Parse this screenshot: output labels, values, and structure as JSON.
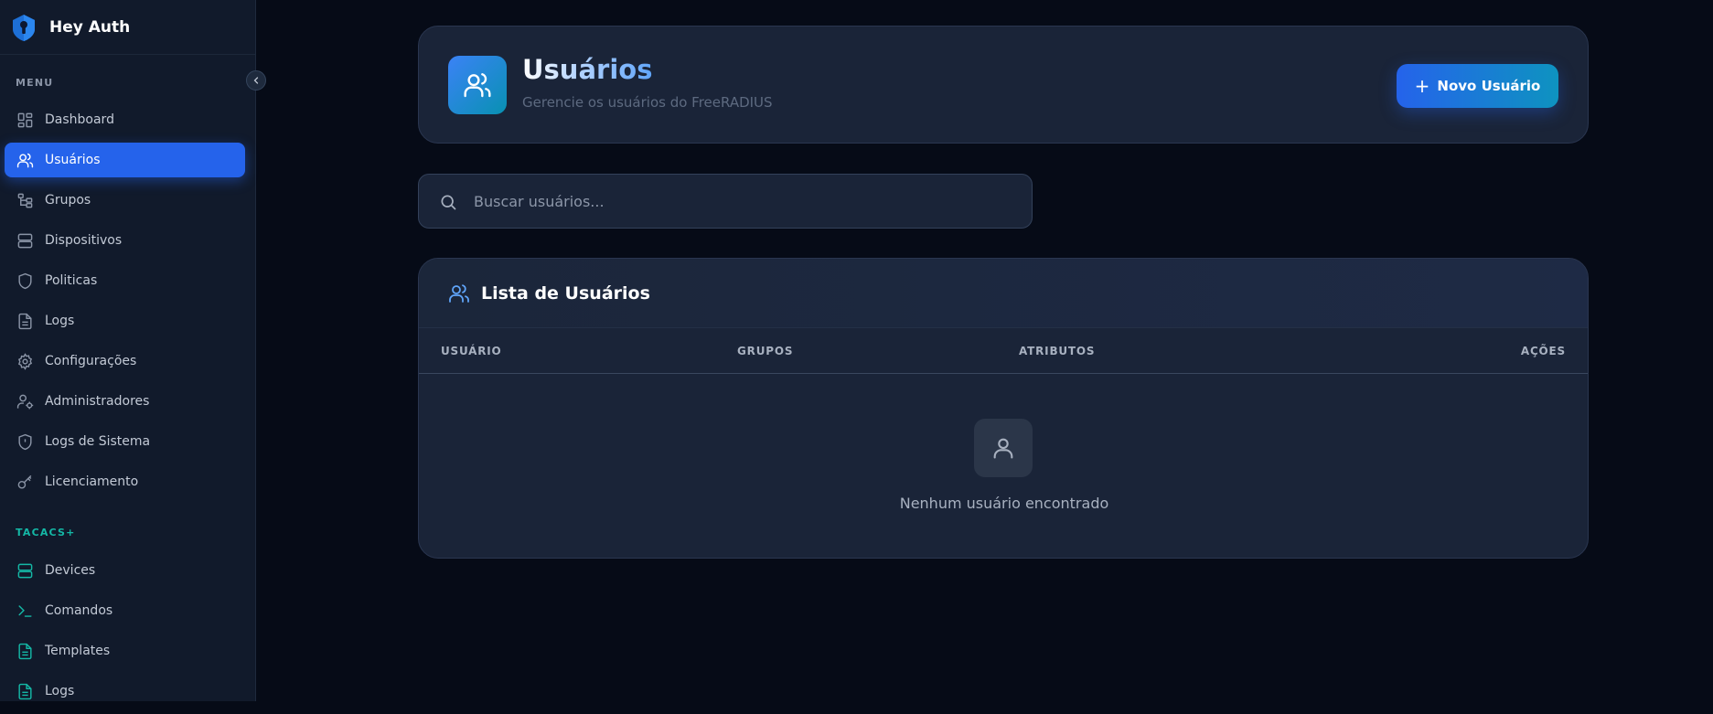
{
  "app": {
    "name": "Hey Auth"
  },
  "sidebar": {
    "menu_label": "MENU",
    "items": [
      {
        "label": "Dashboard",
        "icon": "dashboard-icon"
      },
      {
        "label": "Usuários",
        "icon": "users-icon",
        "active": true
      },
      {
        "label": "Grupos",
        "icon": "groups-icon"
      },
      {
        "label": "Dispositivos",
        "icon": "server-icon"
      },
      {
        "label": "Politicas",
        "icon": "shield-icon"
      },
      {
        "label": "Logs",
        "icon": "file-icon"
      },
      {
        "label": "Configurações",
        "icon": "gear-icon"
      },
      {
        "label": "Administradores",
        "icon": "user-cog-icon"
      },
      {
        "label": "Logs de Sistema",
        "icon": "shield-alert-icon"
      },
      {
        "label": "Licenciamento",
        "icon": "key-icon"
      }
    ],
    "tacacs_label": "TACACS+",
    "tacacs_items": [
      {
        "label": "Devices",
        "icon": "server-icon"
      },
      {
        "label": "Comandos",
        "icon": "terminal-icon"
      },
      {
        "label": "Templates",
        "icon": "file-icon"
      },
      {
        "label": "Logs",
        "icon": "file-icon"
      }
    ]
  },
  "header": {
    "title": "Usuários",
    "subtitle": "Gerencie os usuários do FreeRADIUS",
    "new_button": "Novo Usuário"
  },
  "search": {
    "placeholder": "Buscar usuários..."
  },
  "list": {
    "title": "Lista de Usuários",
    "columns": [
      "USUÁRIO",
      "GRUPOS",
      "ATRIBUTOS",
      "AÇÕES"
    ],
    "empty_text": "Nenhum usuário encontrado"
  },
  "colors": {
    "accent": "#2563eb",
    "teal": "#14b8a6",
    "background": "#060b17",
    "card": "#1a2438"
  }
}
